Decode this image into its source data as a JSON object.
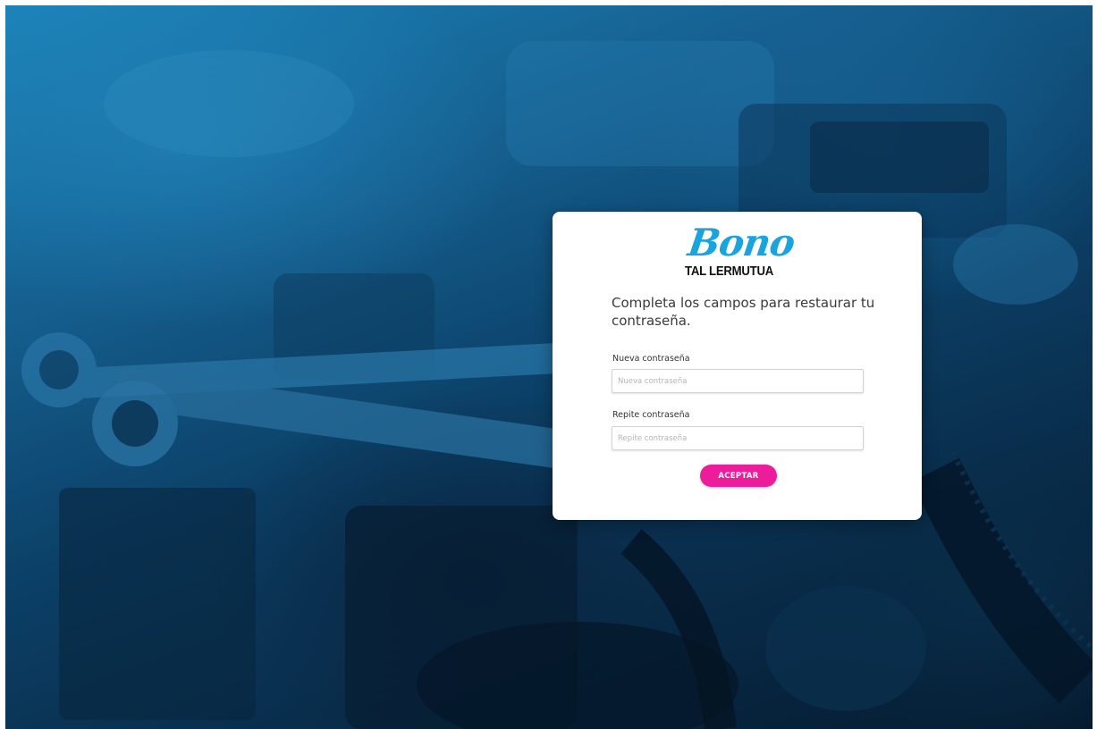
{
  "brand": {
    "logo_script": "Bono",
    "logo_subtitle": "TAL LERMUTUA",
    "script_color": "#1aa3dc",
    "accent_color": "#ec1c9a"
  },
  "form": {
    "heading": "Completa los campos para restaurar tu contraseña.",
    "new_password": {
      "label": "Nueva contraseña",
      "placeholder": "Nueva contraseña",
      "value": ""
    },
    "repeat_password": {
      "label": "Repite contraseña",
      "placeholder": "Repite contraseña",
      "value": ""
    },
    "submit_label": "ACEPTAR"
  },
  "background": {
    "image": "engine-bay-wrenches",
    "tint_color": "#1a6fa8"
  }
}
